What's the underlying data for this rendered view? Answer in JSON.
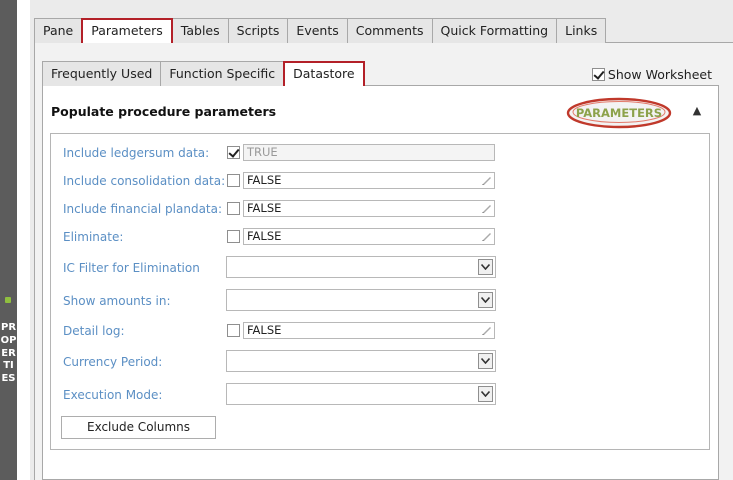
{
  "left_strip": {
    "label": "PROPERTIES"
  },
  "top_tabs": [
    "Pane",
    "Parameters",
    "Tables",
    "Scripts",
    "Events",
    "Comments",
    "Quick Formatting",
    "Links"
  ],
  "sub_tabs": [
    "Frequently Used",
    "Function Specific",
    "Datastore"
  ],
  "show_worksheet": {
    "label": "Show Worksheet",
    "checked": true
  },
  "section": {
    "title": "Populate procedure parameters",
    "logo_text": "PARAMETERS"
  },
  "fields": [
    {
      "label": "Include ledgersum data:",
      "type": "checkbox-text",
      "checked": true,
      "value": "TRUE",
      "disabled": true
    },
    {
      "label": "Include consolidation data:",
      "type": "checkbox-text",
      "checked": false,
      "value": "FALSE"
    },
    {
      "label": "Include financial plandata:",
      "type": "checkbox-text",
      "checked": false,
      "value": "FALSE"
    },
    {
      "label": "Eliminate:",
      "type": "checkbox-text",
      "checked": false,
      "value": "FALSE"
    },
    {
      "label": "IC Filter for Elimination",
      "type": "select",
      "value": ""
    },
    {
      "label": "Show amounts in:",
      "type": "select",
      "value": ""
    },
    {
      "label": "Detail log:",
      "type": "checkbox-text",
      "checked": false,
      "value": "FALSE"
    },
    {
      "label": "Currency Period:",
      "type": "select",
      "value": ""
    },
    {
      "label": "Execution Mode:",
      "type": "select",
      "value": ""
    }
  ],
  "buttons": {
    "exclude_columns": "Exclude Columns"
  },
  "colors": {
    "accent_red": "#b32028",
    "label_blue": "#5b8fc4",
    "logo_green": "#8ca24a"
  }
}
